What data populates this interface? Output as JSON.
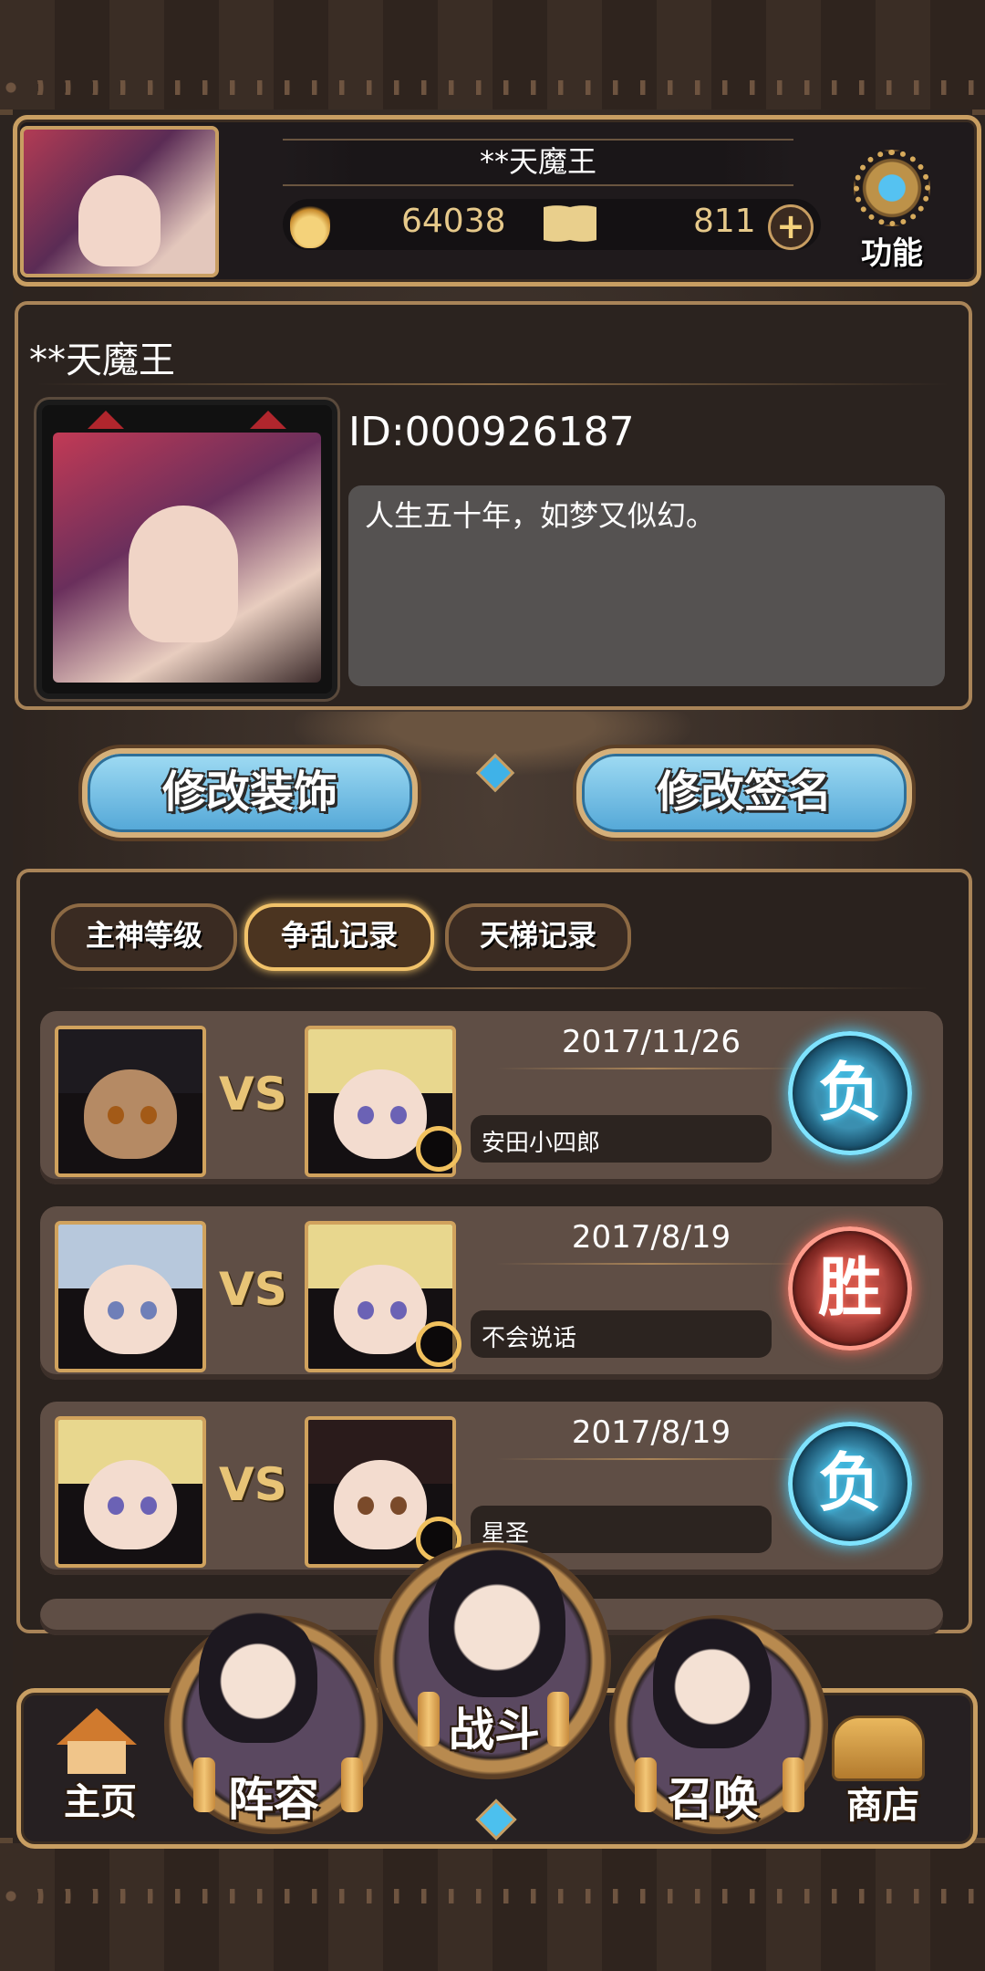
{
  "header": {
    "player_name": "**天魔王",
    "gold": "64038",
    "gems": "811",
    "plus_label": "+",
    "function_label": "功能"
  },
  "profile": {
    "name": "**天魔王",
    "id_text": "ID:000926187",
    "signature": "人生五十年，如梦又似幻。"
  },
  "buttons": {
    "edit_decoration": "修改装饰",
    "edit_signature": "修改签名"
  },
  "tabs": [
    {
      "label": "主神等级",
      "active": false
    },
    {
      "label": "争乱记录",
      "active": true
    },
    {
      "label": "天梯记录",
      "active": false
    }
  ],
  "records": [
    {
      "date": "2017/11/26",
      "opponent": "安田小四郎",
      "result": "负",
      "vs": "VS"
    },
    {
      "date": "2017/8/19",
      "opponent": "不会说话",
      "result": "胜",
      "vs": "VS"
    },
    {
      "date": "2017/8/19",
      "opponent": "星圣",
      "result": "负",
      "vs": "VS"
    }
  ],
  "nav": {
    "home": "主页",
    "lineup": "阵容",
    "battle": "战斗",
    "summon": "召唤",
    "shop": "商店"
  },
  "colors": {
    "frame_gold": "#c89e62",
    "button_blue": "#6fbde4",
    "lose_blue": "#4cd3ff",
    "win_red": "#ff6d5b"
  }
}
